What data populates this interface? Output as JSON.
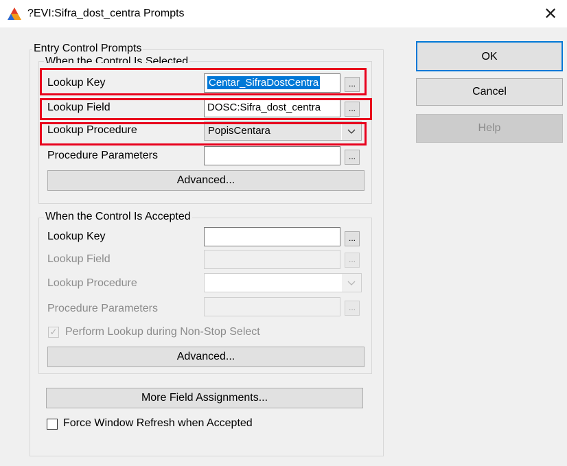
{
  "window": {
    "title": "?EVI:Sifra_dost_centra Prompts",
    "close_glyph": "✕"
  },
  "entry_group": {
    "label": "Entry Control Prompts"
  },
  "selected_group": {
    "label": "When the Control Is Selected",
    "lookup_key_label": "Lookup Key",
    "lookup_key_value": "Centar_SifraDostCentra",
    "lookup_field_label": "Lookup Field",
    "lookup_field_value": "DOSC:Sifra_dost_centra",
    "lookup_procedure_label": "Lookup Procedure",
    "lookup_procedure_value": "PopisCentara",
    "procedure_parameters_label": "Procedure Parameters",
    "procedure_parameters_value": "",
    "advanced_label": "Advanced..."
  },
  "accepted_group": {
    "label": "When the Control Is Accepted",
    "lookup_key_label": "Lookup Key",
    "lookup_field_label": "Lookup Field",
    "lookup_procedure_label": "Lookup Procedure",
    "procedure_parameters_label": "Procedure Parameters",
    "perform_lookup_label": "Perform Lookup during Non-Stop Select",
    "perform_lookup_checked": true,
    "advanced_label": "Advanced..."
  },
  "ellipsis_label": "...",
  "more_field_assignments_label": "More Field Assignments...",
  "force_refresh": {
    "label": "Force Window Refresh when Accepted",
    "checked": false
  },
  "buttons": {
    "ok": "OK",
    "cancel": "Cancel",
    "help": "Help"
  },
  "highlight_color": "#e8001c",
  "selection_color": "#0078d7"
}
